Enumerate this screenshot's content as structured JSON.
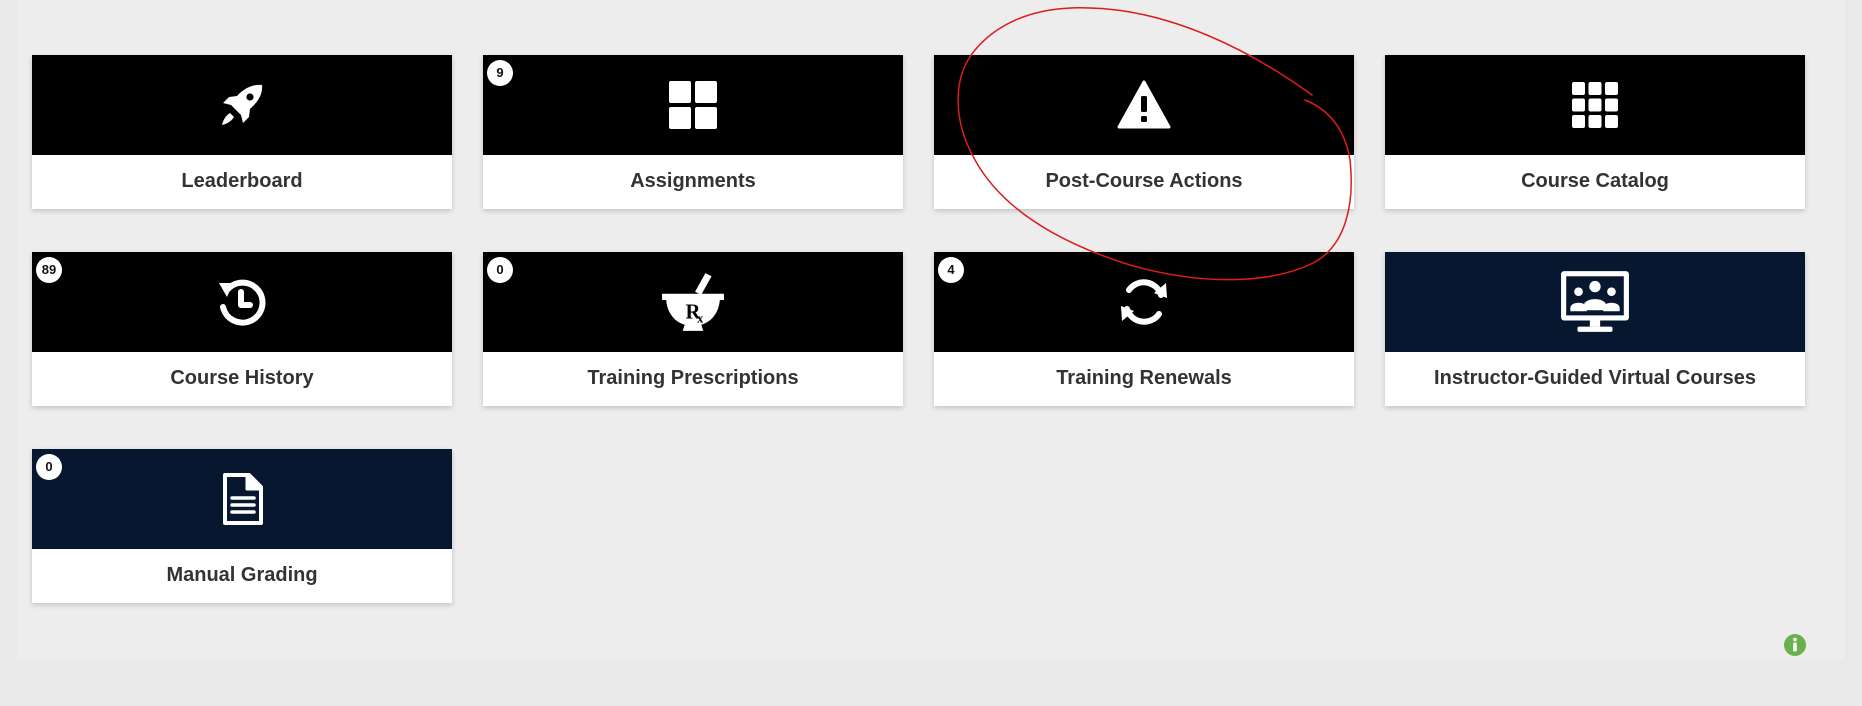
{
  "tiles": [
    {
      "label": "Leaderboard",
      "icon": "rocket-icon",
      "badge": null,
      "theme": "black"
    },
    {
      "label": "Assignments",
      "icon": "four-squares-icon",
      "badge": "9",
      "theme": "black"
    },
    {
      "label": "Post-Course Actions",
      "icon": "warning-icon",
      "badge": null,
      "theme": "black"
    },
    {
      "label": "Course Catalog",
      "icon": "grid-icon",
      "badge": null,
      "theme": "black"
    },
    {
      "label": "Course History",
      "icon": "history-icon",
      "badge": "89",
      "theme": "black"
    },
    {
      "label": "Training Prescriptions",
      "icon": "mortar-pestle-rx-icon",
      "badge": "0",
      "theme": "black"
    },
    {
      "label": "Training Renewals",
      "icon": "refresh-icon",
      "badge": "4",
      "theme": "black"
    },
    {
      "label": "Instructor-Guided Virtual Courses",
      "icon": "virtual-classroom-icon",
      "badge": null,
      "theme": "navy"
    },
    {
      "label": "Manual Grading",
      "icon": "document-icon",
      "badge": "0",
      "theme": "navy"
    }
  ],
  "colors": {
    "tile_black": "#000000",
    "tile_navy": "#07172f",
    "label_text": "#333333",
    "page_bg": "#e9e9e9",
    "info_icon": "#6ab04c",
    "annotation_stroke": "#dd1c1c"
  },
  "info_icon": "info-circle-icon"
}
